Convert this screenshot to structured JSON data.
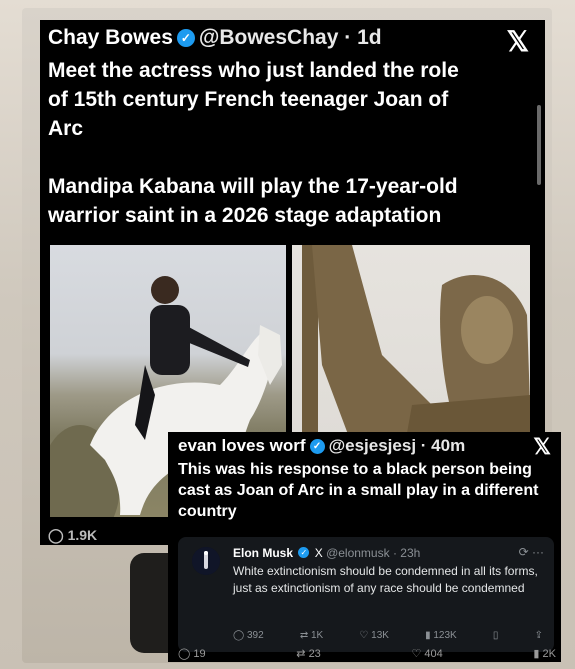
{
  "tweet1": {
    "name": "Chay Bowes",
    "handle": "@BowesChay",
    "time": "1d",
    "lines": [
      "Meet the actress who  just landed the role",
      "of 15th century French teenager  Joan of",
      "Arc"
    ],
    "lines2": [
      "Mandipa Kabana will play the 17-year-old",
      "warrior saint in a 2026 stage adaptation"
    ],
    "reply_count": "1.9K"
  },
  "tweet2": {
    "name": "evan loves worf",
    "handle": "@esjesjesj",
    "time": "40m",
    "text": "This was his response to a black person being cast as Joan of Arc in a small play in a different country"
  },
  "quoted": {
    "name": "Elon Musk",
    "platform": "X",
    "handle": "@elonmusk",
    "time": "23h",
    "text": "White extinctionism should be condemned in all its forms, just as extinctionism of any race should be condemned",
    "actions": [
      "392",
      "1K",
      "13K",
      "123K"
    ]
  },
  "bottom_counts": [
    "19",
    "23",
    "404",
    "2K"
  ]
}
